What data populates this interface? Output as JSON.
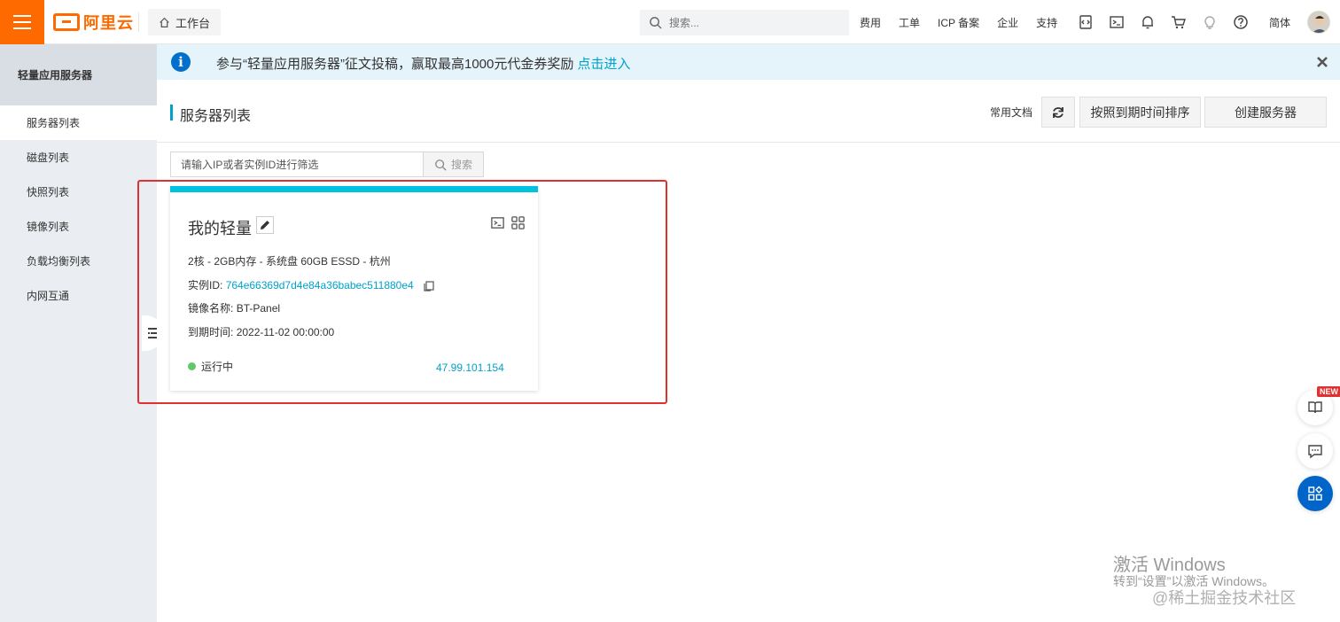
{
  "topbar": {
    "logo_text": "阿里云",
    "workbench_label": "工作台",
    "search_placeholder": "搜索...",
    "nav": [
      "费用",
      "工单",
      "ICP 备案",
      "企业",
      "支持"
    ],
    "language": "简体"
  },
  "sidebar": {
    "title": "轻量应用服务器",
    "items": [
      {
        "label": "服务器列表",
        "active": true
      },
      {
        "label": "磁盘列表"
      },
      {
        "label": "快照列表"
      },
      {
        "label": "镜像列表"
      },
      {
        "label": "负载均衡列表"
      },
      {
        "label": "内网互通"
      }
    ]
  },
  "notice": {
    "text": "参与“轻量应用服务器”征文投稿，赢取最高1000元代金券奖励",
    "link": "点击进入"
  },
  "page": {
    "title": "服务器列表",
    "docs_link": "常用文档",
    "sort_button": "按照到期时间排序",
    "create_button": "创建服务器"
  },
  "filter": {
    "placeholder": "请输入IP或者实例ID进行筛选",
    "button": "搜索"
  },
  "server": {
    "name": "我的轻量",
    "spec": "2核 - 2GB内存 - 系统盘 60GB ESSD - 杭州",
    "instance_label": "实例ID:",
    "instance_id": "764e66369d7d4e84a36babec511880e4",
    "image_label": "镜像名称:",
    "image": "BT-Panel",
    "expire_label": "到期时间:",
    "expire": "2022-11-02 00:00:00",
    "status": "运行中",
    "status_color": "#5fc86b",
    "public_ip": "47.99.101.154"
  },
  "floating": {
    "new_badge": "NEW"
  },
  "watermark": {
    "line1": "激活 Windows",
    "line2": "转到“设置”以激活 Windows。",
    "line3": "@稀土掘金技术社区"
  },
  "colors": {
    "brand": "#ff6a00",
    "accent": "#00a2ca",
    "highlight": "#e03030"
  }
}
